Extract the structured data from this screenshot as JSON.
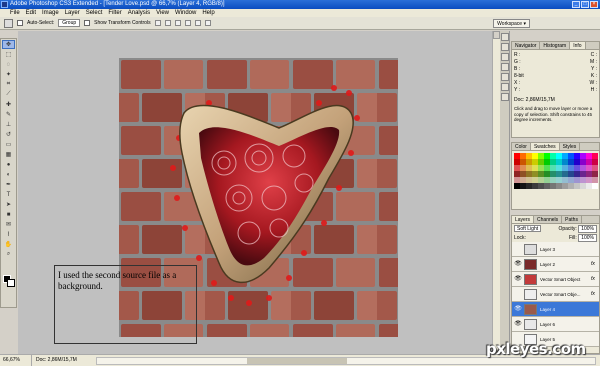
{
  "app": {
    "title": "Adobe Photoshop CS3 Extended - [Tender Love.psd @ 66,7% (Layer 4, RGB/8)]",
    "window_buttons": [
      "_",
      "□",
      "×"
    ]
  },
  "menu": {
    "items": [
      "File",
      "Edit",
      "Image",
      "Layer",
      "Select",
      "Filter",
      "Analysis",
      "View",
      "Window",
      "Help"
    ]
  },
  "options": {
    "auto_select_label": "Auto-Select:",
    "auto_select_value": "Group",
    "transform_controls_label": "Show Transform Controls",
    "workspace_label": "Workspace ▾"
  },
  "canvas": {
    "annotation": "I used the second source file as a background."
  },
  "status": {
    "zoom": "66,67%",
    "doc": "Doc: 2,86M/15,7M"
  },
  "navigator_panel": {
    "tabs": [
      "Navigator",
      "Histogram",
      "Info"
    ],
    "active_tab": "Info",
    "rows": [
      [
        "R :",
        "C :"
      ],
      [
        "G :",
        "M :"
      ],
      [
        "B :",
        "Y :"
      ],
      [
        "8-bit",
        "K :"
      ],
      [
        "X :",
        "W :"
      ],
      [
        "Y :",
        "H :"
      ]
    ],
    "doc": "Doc: 2,86M/15,7M",
    "hint": "Click and drag to move layer or move a copy of selection. Shift constrains to 45 degree increments."
  },
  "color_panel": {
    "tabs": [
      "Color",
      "Swatches",
      "Styles"
    ],
    "active_tab": "Swatches"
  },
  "layers_panel": {
    "tabs": [
      "Layers",
      "Channels",
      "Paths"
    ],
    "active_tab": "Layers",
    "blend_mode": "Soft Light",
    "opacity_label": "Opacity:",
    "opacity_value": "100%",
    "lock_label": "Lock:",
    "fill_label": "Fill:",
    "fill_value": "100%",
    "layers": [
      {
        "name": "Layer 3",
        "selected": false,
        "fx": false,
        "visible": false,
        "thumb_color": "#ddd"
      },
      {
        "name": "Layer 2",
        "selected": false,
        "fx": true,
        "visible": true,
        "thumb_color": "#7a2a2a"
      },
      {
        "name": "Vector Smart Object",
        "selected": false,
        "fx": true,
        "visible": true,
        "thumb_color": "#c23a3a"
      },
      {
        "name": "Vector Smart Obje...",
        "selected": false,
        "fx": true,
        "visible": false,
        "thumb_color": "#eee"
      },
      {
        "name": "Layer 4",
        "selected": true,
        "fx": false,
        "visible": true,
        "thumb_color": "#9a5a4a"
      },
      {
        "name": "Layer 6",
        "selected": false,
        "fx": false,
        "visible": true,
        "thumb_color": "#e8e8e8"
      },
      {
        "name": "Layer 5",
        "selected": false,
        "fx": false,
        "visible": false,
        "thumb_color": "#f4f4f4"
      }
    ]
  },
  "watermark": "pxleyes.com",
  "colors": {
    "title_bar": "#0a4cc0",
    "selected_layer": "#3b78d8",
    "brick": "#8c463c",
    "heart_rim": "#c4a27a",
    "rose": "#b01820"
  }
}
